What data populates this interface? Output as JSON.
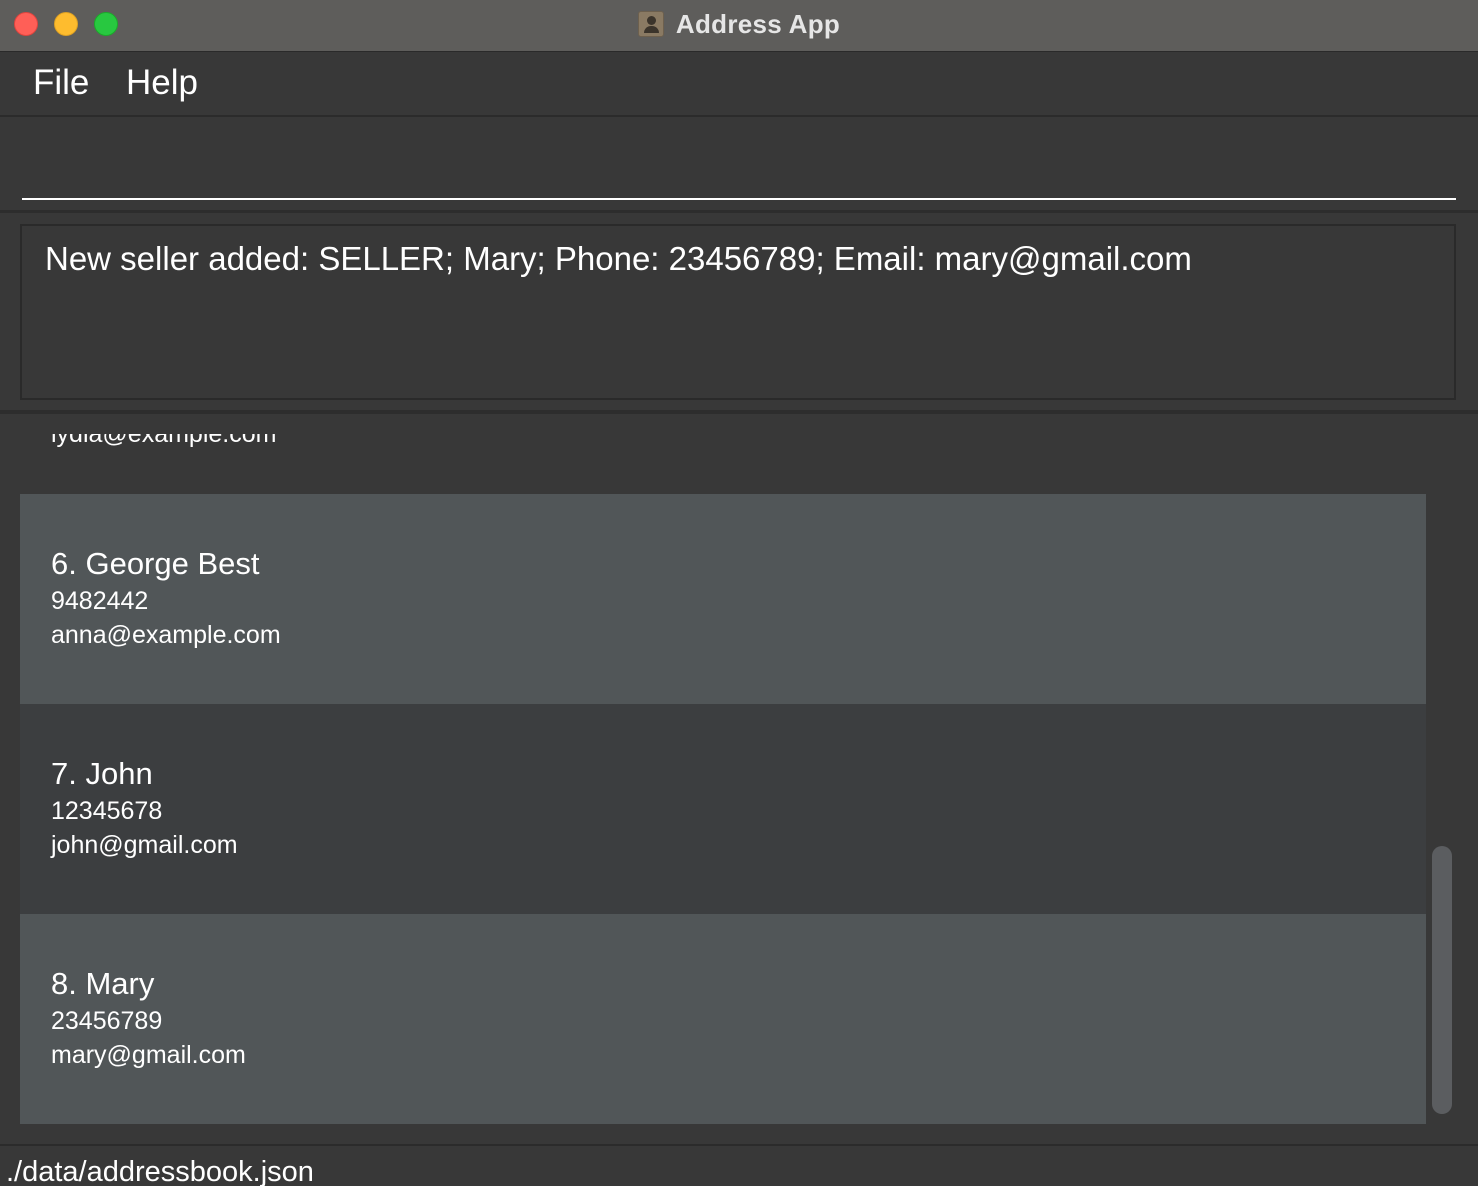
{
  "window": {
    "title": "Address App"
  },
  "menu": {
    "file_label": "File",
    "help_label": "Help"
  },
  "command": {
    "value": "",
    "placeholder": ""
  },
  "result": {
    "message": "New seller added: SELLER; Mary; Phone: 23456789; Email: mary@gmail.com"
  },
  "persons": {
    "partial_top_email": "lydia@example.com",
    "items": [
      {
        "title": "6. George Best",
        "phone": "9482442",
        "email": "anna@example.com"
      },
      {
        "title": "7. John",
        "phone": "12345678",
        "email": "john@gmail.com"
      },
      {
        "title": "8. Mary",
        "phone": "23456789",
        "email": "mary@gmail.com"
      }
    ]
  },
  "status": {
    "file_path": "./data/addressbook.json"
  },
  "colors": {
    "traffic_close": "#ff5f57",
    "traffic_minimize": "#febc2e",
    "traffic_zoom": "#28c840",
    "card_odd": "#3c3e40",
    "card_even": "#515658",
    "background": "#383838"
  }
}
